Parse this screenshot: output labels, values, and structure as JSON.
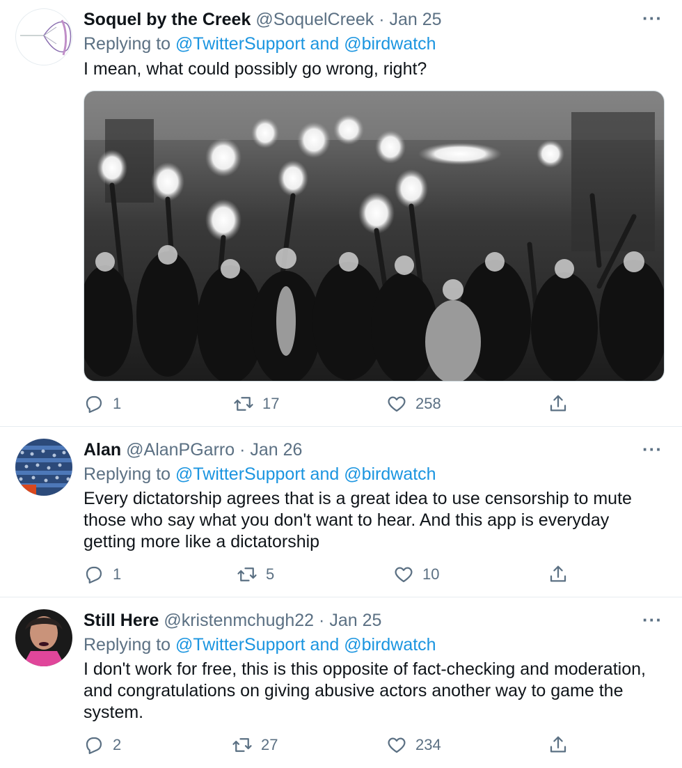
{
  "tweets": [
    {
      "name": "Soquel by the Creek",
      "handle": "@SoquelCreek",
      "date": "Jan 25",
      "replying_prefix": "Replying to",
      "replying_to": "@TwitterSupport and @birdwatch",
      "text": "I mean, what could possibly go wrong, right?",
      "has_media": true,
      "media_description": "",
      "replies": "1",
      "retweets": "17",
      "likes": "258"
    },
    {
      "name": "Alan",
      "handle": "@AlanPGarro",
      "date": "Jan 26",
      "replying_prefix": "Replying to",
      "replying_to": "@TwitterSupport and @birdwatch",
      "text_lines": [
        "Every dictatorship agrees that is a great idea to use censorship to mute",
        "those who say what you don't want to hear. And this app is everyday",
        "getting more like a dictatorship"
      ],
      "replies": "1",
      "retweets": "5",
      "likes": "10"
    },
    {
      "name": "Still Here",
      "handle": "@kristenmchugh22",
      "date": "Jan 25",
      "replying_prefix": "Replying to",
      "replying_to": "@TwitterSupport and @birdwatch",
      "text_lines": [
        "I don't work for free, this is this opposite of fact-checking and moderation,",
        "and congratulations on giving abusive actors another way to game the",
        "system."
      ],
      "replies": "2",
      "retweets": "27",
      "likes": "234"
    }
  ],
  "icons": {
    "reply": "reply-icon",
    "retweet": "retweet-icon",
    "like": "heart-icon",
    "share": "share-icon",
    "more": "more-icon"
  },
  "colors": {
    "link": "#1b95e0",
    "muted": "#5b7083",
    "text": "#0f1419",
    "divider": "#e6ecf0"
  }
}
